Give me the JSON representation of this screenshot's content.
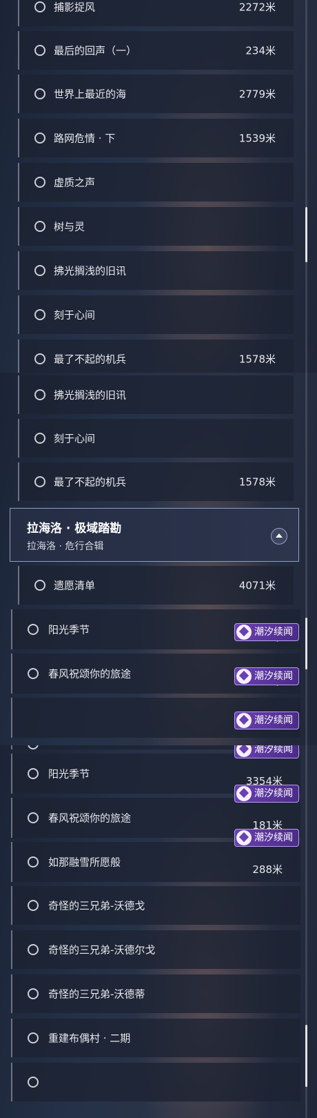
{
  "tag_label": "潮汐续闻",
  "panel_a": {
    "rows": [
      {
        "title": "捕影捉风",
        "distance": "2272米"
      },
      {
        "title": "最后的回声（一）",
        "distance": "234米"
      },
      {
        "title": "世界上最近的海",
        "distance": "2779米"
      },
      {
        "title": "路网危情 · 下",
        "distance": "1539米"
      },
      {
        "title": "虚质之声",
        "distance": ""
      },
      {
        "title": "树与灵",
        "distance": ""
      },
      {
        "title": "拂光搁浅的旧讯",
        "distance": ""
      },
      {
        "title": "刻于心间",
        "distance": ""
      },
      {
        "title": "最了不起的机兵",
        "distance": "1578米"
      }
    ]
  },
  "panel_b": {
    "rows_before": [
      {
        "title": "拂光搁浅的旧讯",
        "distance": ""
      },
      {
        "title": "刻于心间",
        "distance": ""
      },
      {
        "title": "最了不起的机兵",
        "distance": "1578米"
      }
    ],
    "region": {
      "title": "拉海洛 · 极域踏勘",
      "subtitle": "拉海洛 · 危行合辑"
    },
    "rows_after": [
      {
        "title": "遗愿清单",
        "distance": "4071米"
      },
      {
        "title": "阳光季节",
        "distance": "3354米"
      },
      {
        "title": "春风祝颂你的旅途",
        "distance": "181米"
      }
    ]
  },
  "panel_c": {
    "rows": [
      {
        "title": "阳光季节",
        "distance": "3354米"
      },
      {
        "title": "春风祝颂你的旅途",
        "distance": "181米"
      },
      {
        "title": "如那融雪所愿般",
        "distance": "288米"
      },
      {
        "title": "奇怪的三兄弟-沃德戈",
        "distance": ""
      },
      {
        "title": "奇怪的三兄弟-沃德尔戈",
        "distance": ""
      },
      {
        "title": "奇怪的三兄弟-沃德蒂",
        "distance": ""
      },
      {
        "title": "重建布偶村 · 二期",
        "distance": ""
      }
    ]
  }
}
